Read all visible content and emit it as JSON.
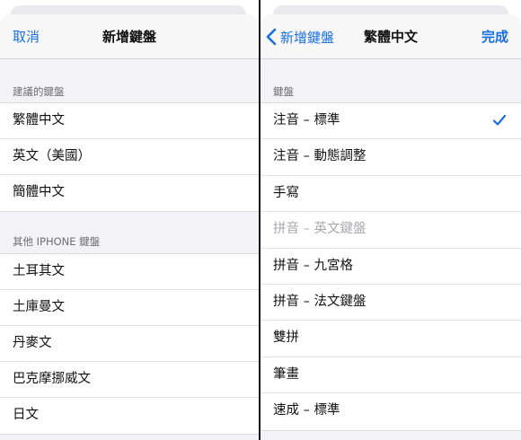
{
  "left_panel": {
    "nav": {
      "cancel_label": "取消",
      "title": "新增鍵盤"
    },
    "suggested_section": {
      "header": "建議的鍵盤",
      "items": [
        "繁體中文",
        "英文（美國）",
        "簡體中文"
      ]
    },
    "other_section": {
      "header": "其他 IPHONE 鍵盤",
      "items": [
        "土耳其文",
        "土庫曼文",
        "丹麥文",
        "巴克摩挪威文",
        "日文"
      ]
    }
  },
  "right_panel": {
    "nav": {
      "back_label": "新增鍵盤",
      "title": "繁體中文",
      "done_label": "完成"
    },
    "section": {
      "header": "鍵盤",
      "items": [
        {
          "label": "注音 – 標準",
          "checked": true,
          "disabled": false
        },
        {
          "label": "注音 – 動態調整",
          "checked": false,
          "disabled": false
        },
        {
          "label": "手寫",
          "checked": false,
          "disabled": false
        },
        {
          "label": "拼音 – 英文鍵盤",
          "checked": false,
          "disabled": true
        },
        {
          "label": "拼音 – 九宮格",
          "checked": false,
          "disabled": false
        },
        {
          "label": "拼音 – 法文鍵盤",
          "checked": false,
          "disabled": false
        },
        {
          "label": "雙拼",
          "checked": false,
          "disabled": false
        },
        {
          "label": "筆畫",
          "checked": false,
          "disabled": false
        },
        {
          "label": "速成 – 標準",
          "checked": false,
          "disabled": false
        }
      ]
    }
  },
  "colors": {
    "accent": "#1a6fe0",
    "background": "#f2f2f7",
    "disabled_text": "#a8a8ad"
  },
  "icons": {
    "back": "chevron-left-icon",
    "check": "checkmark-icon"
  }
}
